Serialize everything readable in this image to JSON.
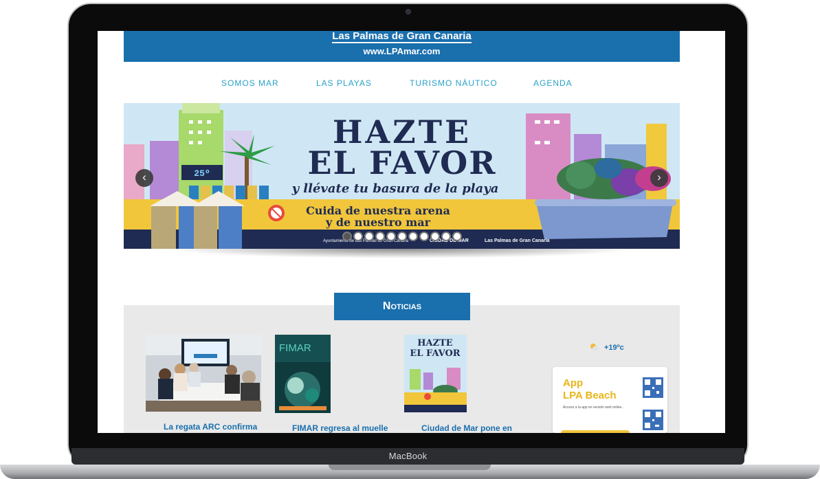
{
  "device": {
    "brand_label": "MacBook"
  },
  "site": {
    "title": "Las Palmas de Gran Canaria",
    "url": "www.LPAmar.com",
    "nav": [
      "SOMOS MAR",
      "LAS PLAYAS",
      "TURISMO NÁUTICO",
      "AGENDA"
    ]
  },
  "banner": {
    "headline_1": "HAZTE",
    "headline_2": "EL FAVOR",
    "tagline": "y llévate tu basura de la playa",
    "subline_1": "Cuida de nuestra arena",
    "subline_2": "y de nuestro mar",
    "thermo": "25º",
    "prev_arrow": "‹",
    "next_arrow": "›",
    "slide_count": 11,
    "active_slide": 1,
    "footer_logos": [
      "Ayuntamiento de Las Palmas de Gran Canaria",
      "CIUDAD DE MAR",
      "Las Palmas de Gran Canaria"
    ]
  },
  "news": {
    "heading": "Noticias",
    "items": [
      {
        "title": "La regata ARC confirma"
      },
      {
        "title": "FIMAR regresa al muelle",
        "poster_label": "FIMAR"
      },
      {
        "title": "Ciudad de Mar pone en",
        "poster_label_1": "HAZTE",
        "poster_label_2": "EL FAVOR"
      }
    ]
  },
  "weather": {
    "temperature": "+19ºc",
    "icon": "partly-sunny-icon"
  },
  "app_promo": {
    "title": "App\nLPA Beach",
    "subtitle": "Acceso a la app en versión web online.."
  },
  "colors": {
    "brand_blue": "#1a6fad",
    "nav_text": "#27a1c9",
    "app_yellow": "#e8b51a"
  }
}
